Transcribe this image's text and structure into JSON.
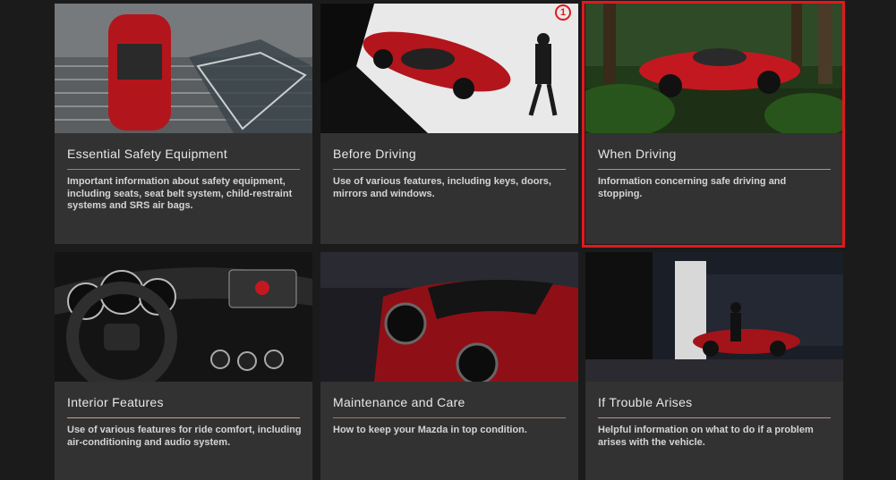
{
  "accent_color": "#e0191e",
  "callout_marker": "①",
  "cards": [
    {
      "title": "Essential Safety Equipment",
      "description": "Important information about safety equipment, including seats, seat belt system, child-restraint systems and SRS air bags.",
      "rule_color": "#8a8a7a",
      "image": "red-convertible-top-view"
    },
    {
      "title": "Before Driving",
      "description": "Use of various features, including keys, doors, mirrors and windows.",
      "rule_color": "#8a9a8a",
      "image": "red-convertible-with-driver"
    },
    {
      "title": "When Driving",
      "description": "Information concerning safe driving and stopping.",
      "rule_color": "#9aa08a",
      "image": "red-convertible-forest-road"
    },
    {
      "title": "Interior Features",
      "description": "Use of various features for ride comfort, including air-conditioning and audio system.",
      "rule_color": "#c8a880",
      "image": "dashboard-steering-wheel"
    },
    {
      "title": "Maintenance and Care",
      "description": "How to keep your Mazda in top condition.",
      "rule_color": "#b0706a",
      "image": "red-convertible-dusk"
    },
    {
      "title": "If Trouble Arises",
      "description": "Helpful information on what to do if a problem arises with the vehicle.",
      "rule_color": "#c08a9a",
      "image": "red-convertible-roadside-night"
    }
  ]
}
